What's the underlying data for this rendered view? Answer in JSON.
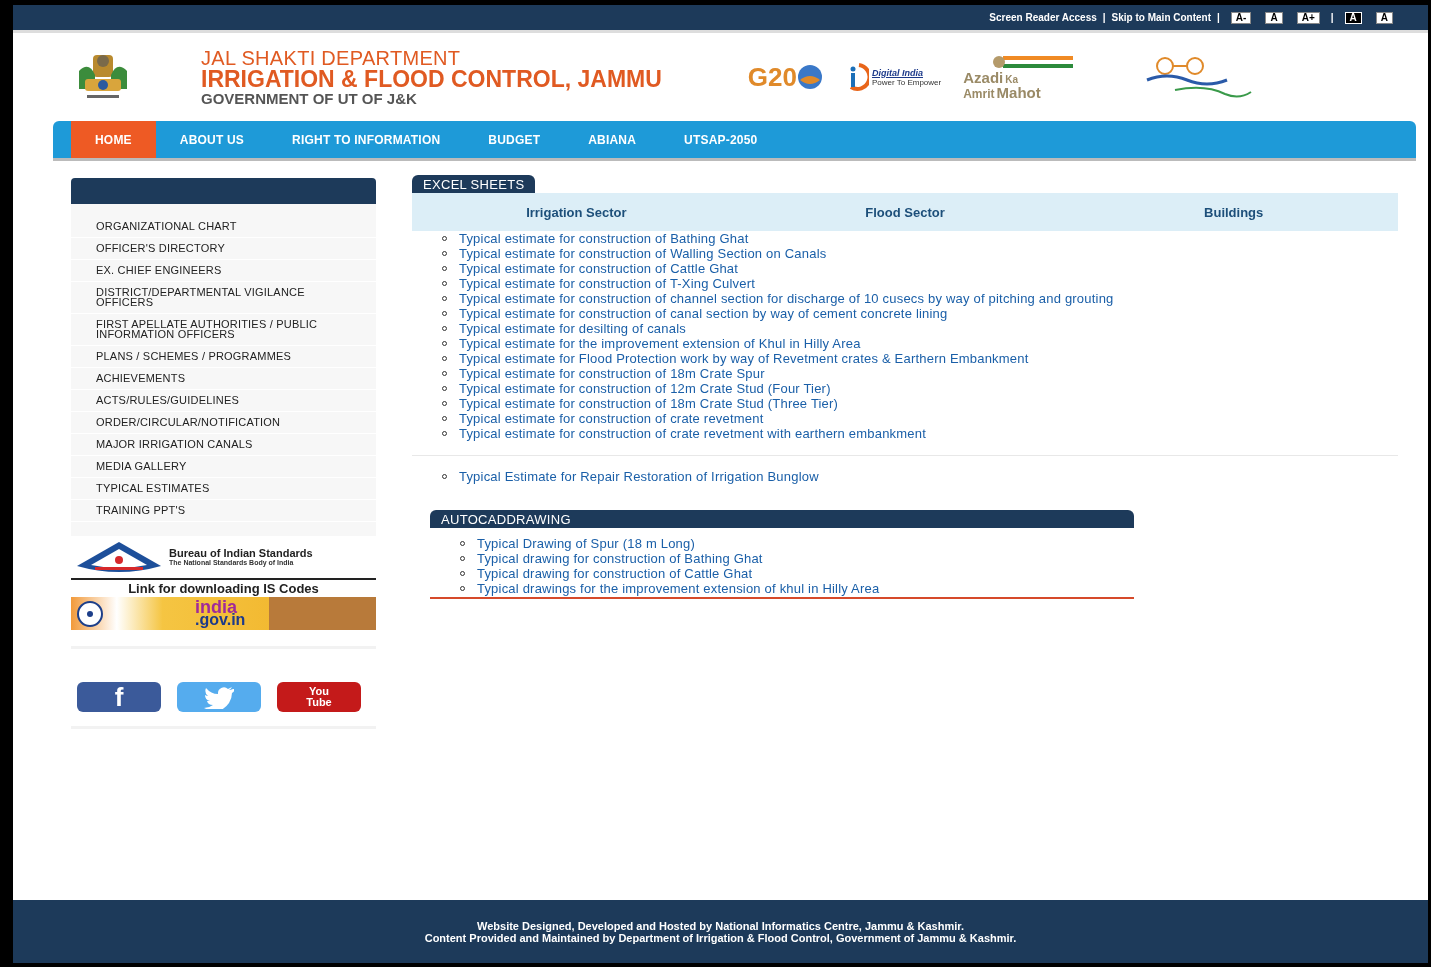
{
  "top_bar": {
    "links": [
      {
        "label": "Screen Reader Access"
      },
      {
        "label": "Skip to Main Content"
      }
    ],
    "separators": [
      "|",
      "|",
      "|"
    ],
    "font_buttons": [
      {
        "label": "A-",
        "kind": "light"
      },
      {
        "label": "A",
        "kind": "light"
      },
      {
        "label": "A+",
        "kind": "light"
      },
      {
        "label": "A",
        "kind": "dark"
      },
      {
        "label": "A",
        "kind": "light"
      }
    ]
  },
  "header": {
    "line1": "JAL SHAKTI DEPARTMENT",
    "line2": "IRRIGATION & FLOOD CONTROL, JAMMU",
    "line3": "GOVERNMENT OF UT OF J&K",
    "logos": [
      {
        "kind": "g20",
        "texts": [
          "G20"
        ]
      },
      {
        "kind": "digital",
        "texts": [
          "Digital India",
          "Power To Empower"
        ]
      },
      {
        "kind": "azadi",
        "texts": [
          "Azadi",
          "Ka",
          "Amrit",
          "Mahot"
        ]
      },
      {
        "kind": "swachh"
      }
    ]
  },
  "nav": [
    {
      "label": "HOME",
      "selected": true
    },
    {
      "label": "ABOUT US",
      "selected": false
    },
    {
      "label": "RIGHT TO INFORMATION",
      "selected": false
    },
    {
      "label": "BUDGET",
      "selected": false
    },
    {
      "label": "ABIANA",
      "selected": false
    },
    {
      "label": "UTSAP-2050",
      "selected": false
    }
  ],
  "sidebar": {
    "items": [
      "ORGANIZATIONAL CHART",
      "OFFICER'S DIRECTORY",
      "EX. CHIEF ENGINEERS",
      "DISTRICT/DEPARTMENTAL VIGILANCE OFFICERS",
      "FIRST APELLATE AUTHORITIES / PUBLIC INFORMATION OFFICERS",
      "PLANS / SCHEMES / PROGRAMMES",
      "ACHIEVEMENTS",
      "ACTS/RULES/GUIDELINES",
      "ORDER/CIRCULAR/NOTIFICATION",
      "MAJOR IRRIGATION CANALS",
      "MEDIA GALLERY",
      "TYPICAL ESTIMATES",
      "TRAINING PPT'S"
    ],
    "bis": {
      "title": "Bureau of Indian Standards",
      "subtitle": "The National Standards Body of India"
    },
    "is_codes": "Link for downloading IS Codes",
    "india_portal": {
      "line1": "india",
      "line2": ".gov.in"
    },
    "social": [
      {
        "kind": "facebook",
        "label": "f"
      },
      {
        "kind": "twitter"
      },
      {
        "kind": "youtube",
        "label": "You Tube"
      }
    ]
  },
  "excel": {
    "heading": "EXCEL SHEETS",
    "tabs": [
      "Irrigation Sector",
      "Flood Sector",
      "Buildings"
    ],
    "items": [
      "Typical estimate for construction of Bathing Ghat",
      "Typical estimate for construction of Walling Section on Canals",
      "Typical estimate for construction of Cattle Ghat",
      "Typical estimate for construction of T-Xing Culvert",
      "Typical estimate for construction of channel section for discharge of 10 cusecs by way of pitching and grouting",
      "Typical estimate for construction of canal section by way of cement concrete lining",
      "Typical estimate for desilting of canals",
      "Typical estimate for the improvement extension of Khul in Hilly Area",
      "Typical estimate for Flood Protection work by way of Revetment crates & Earthern Embankment",
      "Typical estimate for construction of 18m Crate Spur",
      "Typical estimate for construction of 12m Crate Stud (Four Tier)",
      "Typical estimate for construction of 18m Crate Stud (Three Tier)",
      "Typical estimate for construction of crate revetment",
      "Typical estimate for construction of crate revetment with earthern embankment"
    ],
    "building_items": [
      "Typical Estimate for Repair Restoration of Irrigation Bunglow"
    ]
  },
  "autocad": {
    "heading": "AUTOCADDRAWING",
    "items": [
      "Typical Drawing of Spur (18 m Long)",
      "Typical drawing for construction of Bathing Ghat",
      "Typical drawing for construction of Cattle Ghat",
      "Typical drawings for the improvement extension of khul in Hilly Area"
    ]
  },
  "footer": [
    "Website Designed, Developed and Hosted by National Informatics Centre, Jammu & Kashmir.",
    "Content Provided and Maintained by Department of Irrigation & Flood Control, Government of Jammu & Kashmir."
  ]
}
